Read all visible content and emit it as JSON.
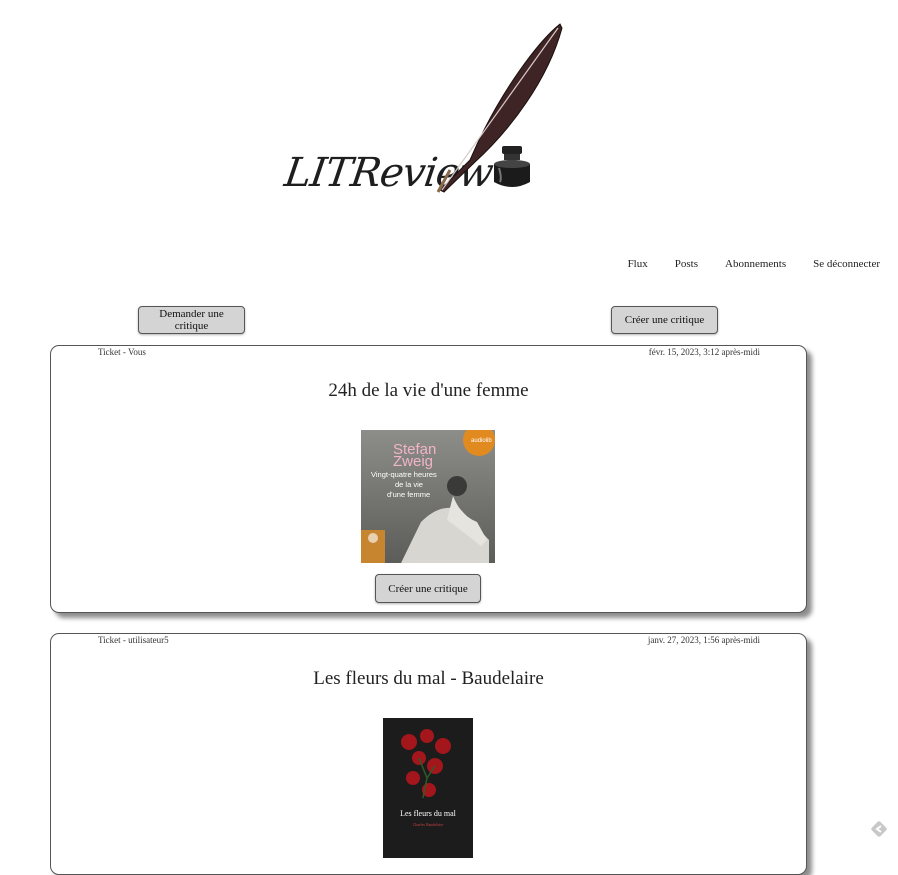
{
  "brand": {
    "logo_text": "LITReview"
  },
  "nav": {
    "items": [
      {
        "label": "Flux"
      },
      {
        "label": "Posts"
      },
      {
        "label": "Abonnements"
      },
      {
        "label": "Se déconnecter"
      }
    ]
  },
  "actions": {
    "ask_review": "Demander une critique",
    "create_review": "Créer une critique"
  },
  "tickets": [
    {
      "author": "Ticket - Vous",
      "date": "févr. 15, 2023, 3:12 après-midi",
      "title": "24h de la vie d'une femme",
      "button": "Créer une critique",
      "cover": {
        "author": "Stefan",
        "author2": "Zweig",
        "title_lines": [
          "Vingt-quatre heures",
          "de la vie",
          "d'une femme"
        ],
        "badge": "audiolib"
      }
    },
    {
      "author": "Ticket - utilisateur5",
      "date": "janv. 27, 2023, 1:56 après-midi",
      "title": "Les fleurs du mal - Baudelaire",
      "cover": {
        "title": "Les fleurs du mal",
        "subtitle": "Charles Baudelaire"
      }
    }
  ],
  "colors": {
    "button_bg": "#d4d4d4",
    "quill": "#4a2a2a"
  },
  "icons": [
    "quill-icon",
    "inkwell-icon",
    "corner-arrow-icon"
  ]
}
